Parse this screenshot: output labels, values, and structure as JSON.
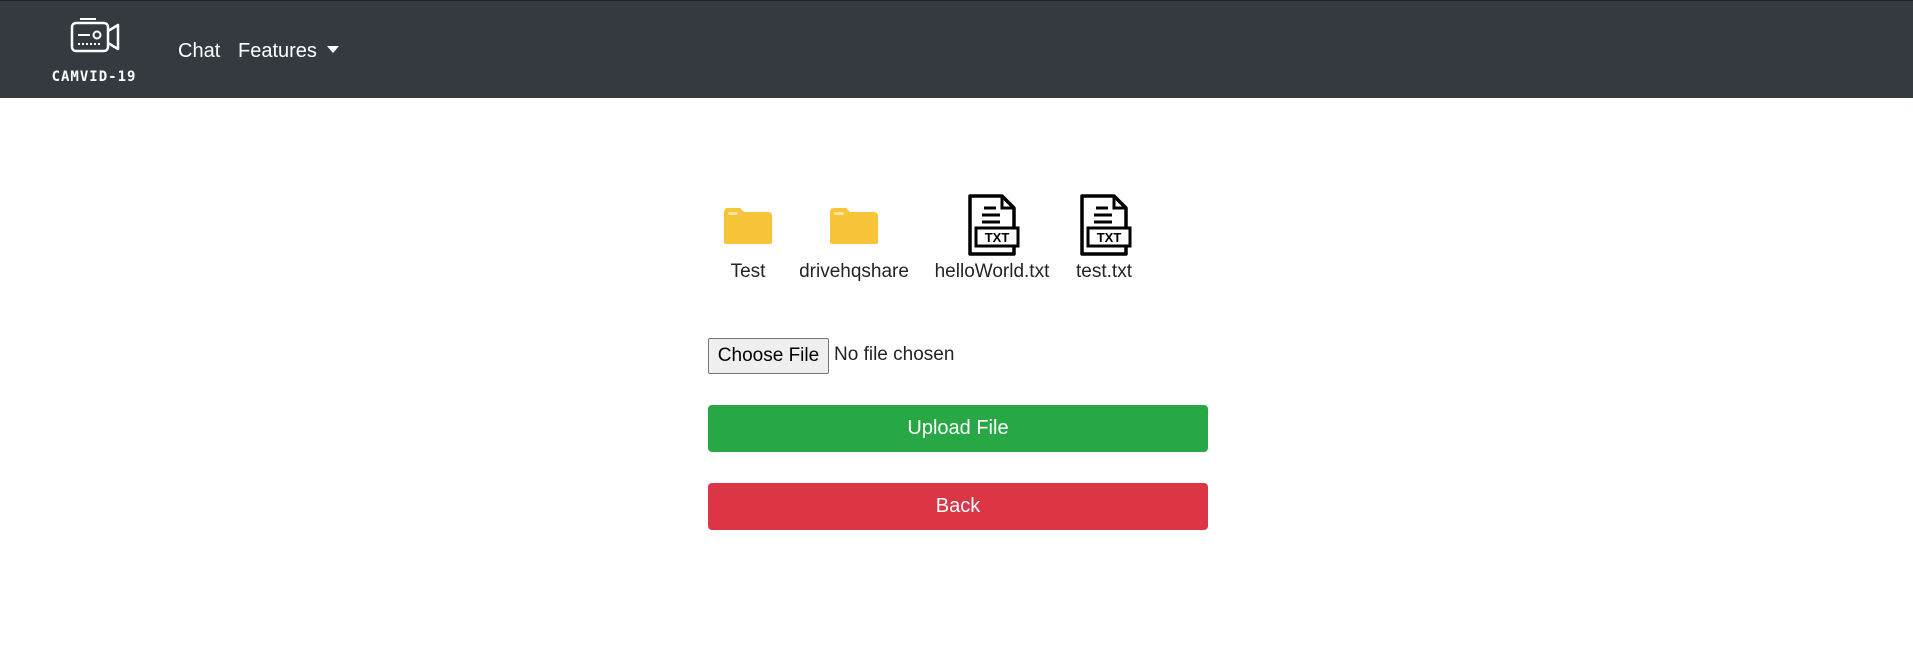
{
  "nav": {
    "brand": "CAMVID-19",
    "links": [
      {
        "label": "Chat"
      },
      {
        "label": "Features"
      }
    ]
  },
  "files": [
    {
      "name": "Test",
      "type": "folder"
    },
    {
      "name": "drivehqshare",
      "type": "folder"
    },
    {
      "name": "helloWorld.txt",
      "type": "txt"
    },
    {
      "name": "test.txt",
      "type": "txt"
    }
  ],
  "txt_badge": "TXT",
  "upload": {
    "choose_label": "Choose File",
    "status": "No file chosen",
    "upload_label": "Upload File",
    "back_label": "Back"
  },
  "colors": {
    "navbar": "#343a40",
    "folder": "#f8c53a",
    "upload": "#28a745",
    "back": "#dc3545"
  }
}
